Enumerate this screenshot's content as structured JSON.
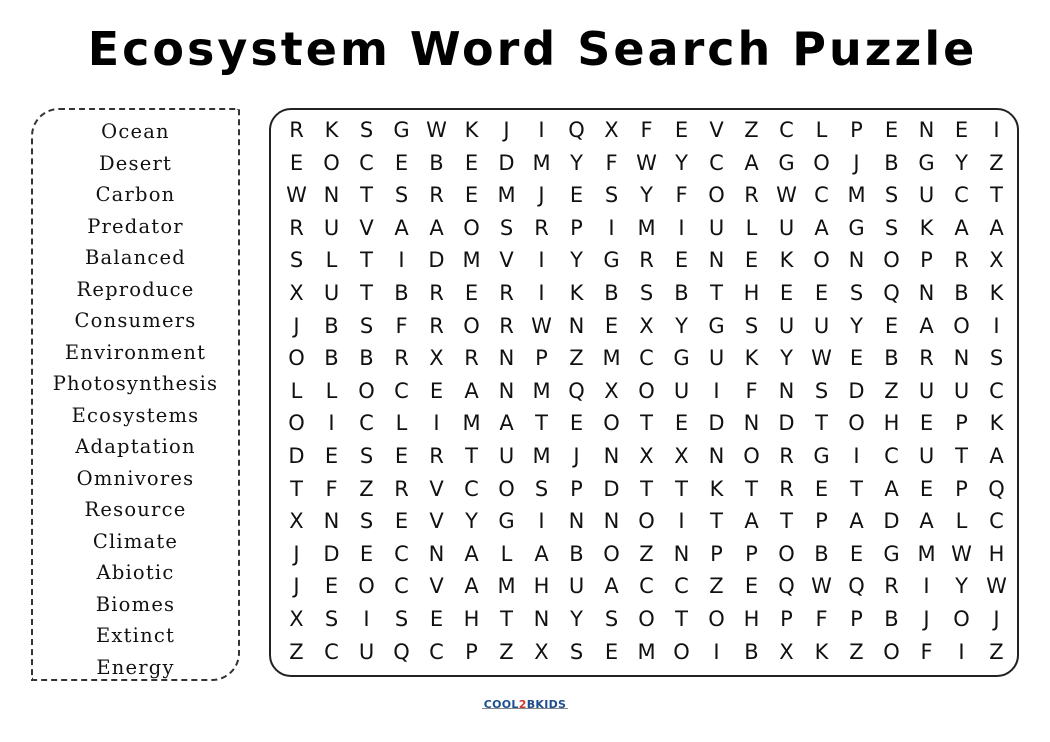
{
  "title": "Ecosystem Word Search Puzzle",
  "words": [
    "Ocean",
    "Desert",
    "Carbon",
    "Predator",
    "Balanced",
    "Reproduce",
    "Consumers",
    "Environment",
    "Photosynthesis",
    "Ecosystems",
    "Adaptation",
    "Omnivores",
    "Resource",
    "Climate",
    "Abiotic",
    "Biomes",
    "Extinct",
    "Energy"
  ],
  "grid": [
    "RKSGWKJIQXFEVZCLPENEI",
    "EOCEBEDMYFWYCAGOJBGYZ",
    "WNTSREMJESYFORWCMSUCT",
    "RUVAAOSRPIMIULUAGSKAA",
    "SLTIDMVIYGRENEKONOPRX",
    "XUTBRERIKBSBTHEESQNBK",
    "JBSFRORWNEXYGSUUYEAOI",
    "OBBRXRNPZMCGUKYWEBRNS",
    "LLOCEANMQXOUIFNSDZUUC",
    "OICLIMATEOTEDNDTOHEPK",
    "DESERTUMJNXXNORGICUTA",
    "TFZRVCOSPDTTKTRETAEPQ",
    "XNSEVYGINNOITATPADALC",
    "JDECNALABOZNPPOBEGMWH",
    "JEOCVAMHUACCZEQWQRIYW",
    "XSISEHTNYSOTOHPFPBJOJ",
    "ZCUQCPZXSEMOIBXKZOFIZ"
  ],
  "logo": {
    "part1": "COOL",
    "part2": "2",
    "part3": "BKIDS"
  }
}
